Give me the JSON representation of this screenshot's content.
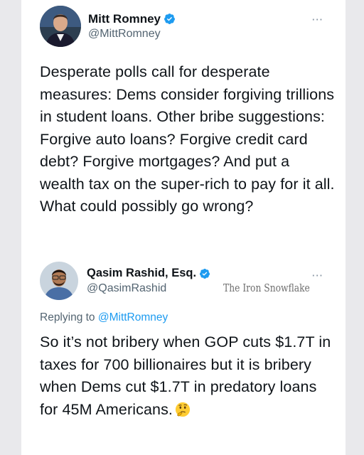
{
  "original_tweet": {
    "display_name": "Mitt Romney",
    "handle": "@MittRomney",
    "verified": true,
    "text": "Desperate polls call for desperate measures: Dems consider forgiving trillions in student loans. Other bribe suggestions: Forgive auto loans? Forgive credit card debt? Forgive mortgages? And put a wealth tax on the super-rich to pay for it all. What could possibly go wrong?",
    "more_label": "···"
  },
  "reply_tweet": {
    "display_name": "Qasim Rashid, Esq.",
    "handle": "@QasimRashid",
    "verified": true,
    "replying_prefix": "Replying to",
    "replying_to": "@MittRomney",
    "text": "So it’s not bribery when GOP cuts $1.7T in taxes for 700 billionaires but it is bribery when Dems cut $1.7T in predatory loans for 45M Americans.",
    "emoji": "thinking-face-icon",
    "more_label": "···"
  },
  "watermark": "The Iron Snowflake",
  "colors": {
    "text_primary": "#0f1419",
    "text_secondary": "#536471",
    "link": "#1d9bf0",
    "verified_badge": "#1d9bf0",
    "side_panel": "#e9e9ec"
  }
}
